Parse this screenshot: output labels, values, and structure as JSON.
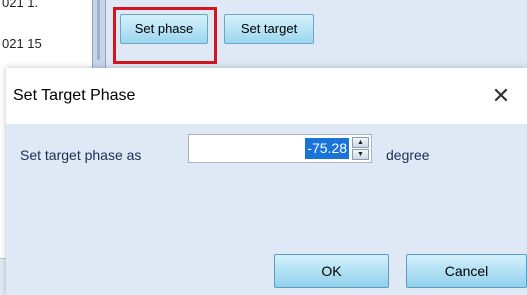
{
  "background": {
    "list_rows": [
      "021 1.",
      "021 15",
      "",
      "",
      "",
      ""
    ],
    "toolbar": {
      "set_phase_label": "Set phase",
      "set_target_label": "Set target"
    }
  },
  "dialog": {
    "title": "Set Target Phase",
    "close_glyph": "✕",
    "field_label": "Set target phase as",
    "value": "-75.28",
    "unit": "degree",
    "ok_label": "OK",
    "cancel_label": "Cancel"
  },
  "colors": {
    "highlight": "#d4151e",
    "selection": "#1a73d9",
    "button_gradient_top": "#d3f1fb",
    "button_gradient_bottom": "#91d1ec"
  }
}
